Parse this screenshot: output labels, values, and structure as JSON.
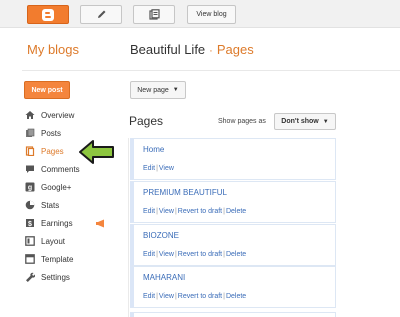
{
  "topbar": {
    "view_blog": "View blog"
  },
  "header": {
    "left_title": "My blogs",
    "blog_name": "Beautiful Life",
    "separator": "·",
    "section": "Pages"
  },
  "sidebar": {
    "new_post": "New post",
    "items": [
      {
        "label": "Overview",
        "icon": "home-icon"
      },
      {
        "label": "Posts",
        "icon": "posts-icon"
      },
      {
        "label": "Pages",
        "icon": "pages-icon"
      },
      {
        "label": "Comments",
        "icon": "comments-icon"
      },
      {
        "label": "Google+",
        "icon": "google-plus-icon"
      },
      {
        "label": "Stats",
        "icon": "stats-icon"
      },
      {
        "label": "Earnings",
        "icon": "earnings-icon"
      },
      {
        "label": "Layout",
        "icon": "layout-icon"
      },
      {
        "label": "Template",
        "icon": "template-icon"
      },
      {
        "label": "Settings",
        "icon": "settings-icon"
      }
    ],
    "active_item": "Pages"
  },
  "main": {
    "new_page": "New page",
    "title": "Pages",
    "show_pages_label": "Show pages as",
    "show_pages_value": "Don't show",
    "pages": [
      {
        "title": "Home",
        "edit": "Edit",
        "view": "View"
      },
      {
        "title": "PREMIUM BEAUTIFUL",
        "edit": "Edit",
        "view": "View",
        "revert": "Revert to draft",
        "delete": "Delete"
      },
      {
        "title": "BIOZONE",
        "edit": "Edit",
        "view": "View",
        "revert": "Revert to draft",
        "delete": "Delete"
      },
      {
        "title": "MAHARANI",
        "edit": "Edit",
        "view": "View",
        "revert": "Revert to draft",
        "delete": "Delete"
      }
    ]
  },
  "colors": {
    "accent": "#dd7a2a",
    "link": "#3a6cb8",
    "arrow": "#8dc63f"
  }
}
